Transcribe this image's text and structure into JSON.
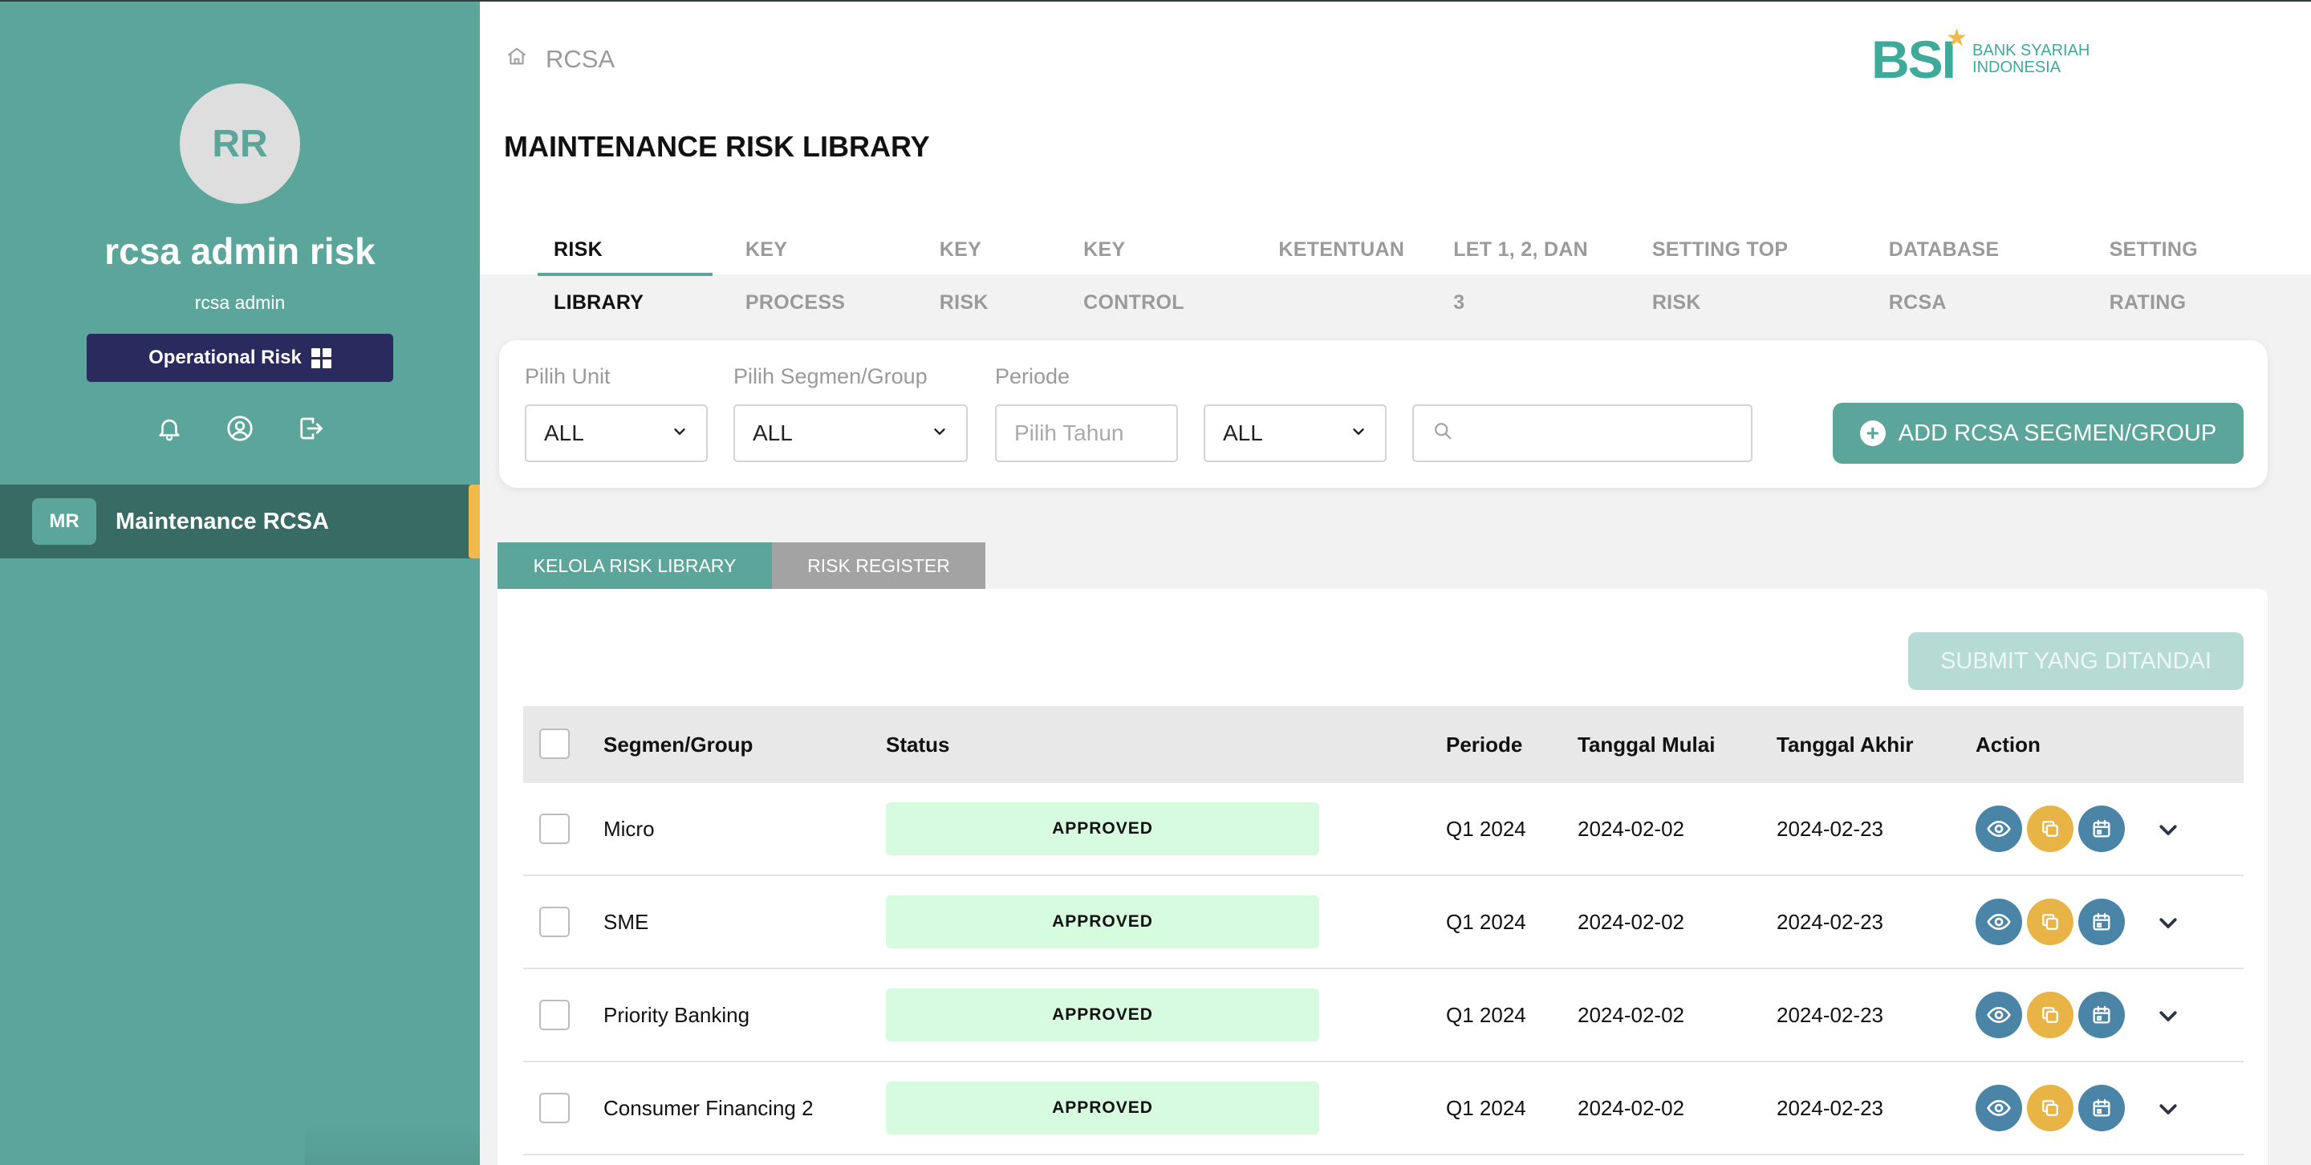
{
  "sidebar": {
    "avatar_initials": "RR",
    "user_name": "rcsa admin risk",
    "user_role": "rcsa admin",
    "module_label": "Operational Risk",
    "nav_items": [
      {
        "badge": "MR",
        "label": "Maintenance RCSA",
        "active": true
      }
    ]
  },
  "header": {
    "breadcrumb": "RCSA",
    "page_title": "MAINTENANCE RISK LIBRARY",
    "logo": {
      "mark": "BSI",
      "line1": "BANK SYARIAH",
      "line2": "INDONESIA"
    },
    "tabs": [
      {
        "label": "RISK LIBRARY",
        "active": true
      },
      {
        "label": "KEY PROCESS"
      },
      {
        "label": "KEY RISK"
      },
      {
        "label": "KEY CONTROL"
      },
      {
        "label": "KETENTUAN"
      },
      {
        "label": "LET 1, 2, DAN 3"
      },
      {
        "label": "SETTING TOP RISK"
      },
      {
        "label": "DATABASE RCSA"
      },
      {
        "label": "SETTING RATING"
      }
    ]
  },
  "filters": {
    "unit_label": "Pilih Unit",
    "unit_value": "ALL",
    "segment_label": "Pilih Segmen/Group",
    "segment_value": "ALL",
    "period_label": "Periode",
    "year_placeholder": "Pilih Tahun",
    "quarter_value": "ALL",
    "search_value": "",
    "add_button": "ADD RCSA SEGMEN/GROUP"
  },
  "subtabs": {
    "kelola": "KELOLA RISK LIBRARY",
    "register": "RISK REGISTER"
  },
  "table": {
    "submit_button": "SUBMIT YANG DITANDAI",
    "columns": {
      "segment": "Segmen/Group",
      "status": "Status",
      "period": "Periode",
      "start": "Tanggal Mulai",
      "end": "Tanggal Akhir",
      "action": "Action"
    },
    "rows": [
      {
        "segment": "Micro",
        "status": "APPROVED",
        "period": "Q1 2024",
        "start": "2024-02-02",
        "end": "2024-02-23"
      },
      {
        "segment": "SME",
        "status": "APPROVED",
        "period": "Q1 2024",
        "start": "2024-02-02",
        "end": "2024-02-23"
      },
      {
        "segment": "Priority Banking",
        "status": "APPROVED",
        "period": "Q1 2024",
        "start": "2024-02-02",
        "end": "2024-02-23"
      },
      {
        "segment": "Consumer Financing 2",
        "status": "APPROVED",
        "period": "Q1 2024",
        "start": "2024-02-02",
        "end": "2024-02-23"
      }
    ]
  },
  "colors": {
    "sidebar": "#5ba59b",
    "sidebar_active": "#376b63",
    "module_button": "#292a5e",
    "accent_bar": "#f1b84a",
    "action_view": "#4a84a6",
    "action_copy": "#e8b446",
    "status_bg": "#d6fbdf"
  },
  "icons": [
    "home-icon",
    "bell-icon",
    "user-circle-icon",
    "logout-icon",
    "grid-icon",
    "search-icon",
    "plus-circle-icon",
    "eye-icon",
    "copy-icon",
    "calendar-icon",
    "chevron-down-icon"
  ]
}
